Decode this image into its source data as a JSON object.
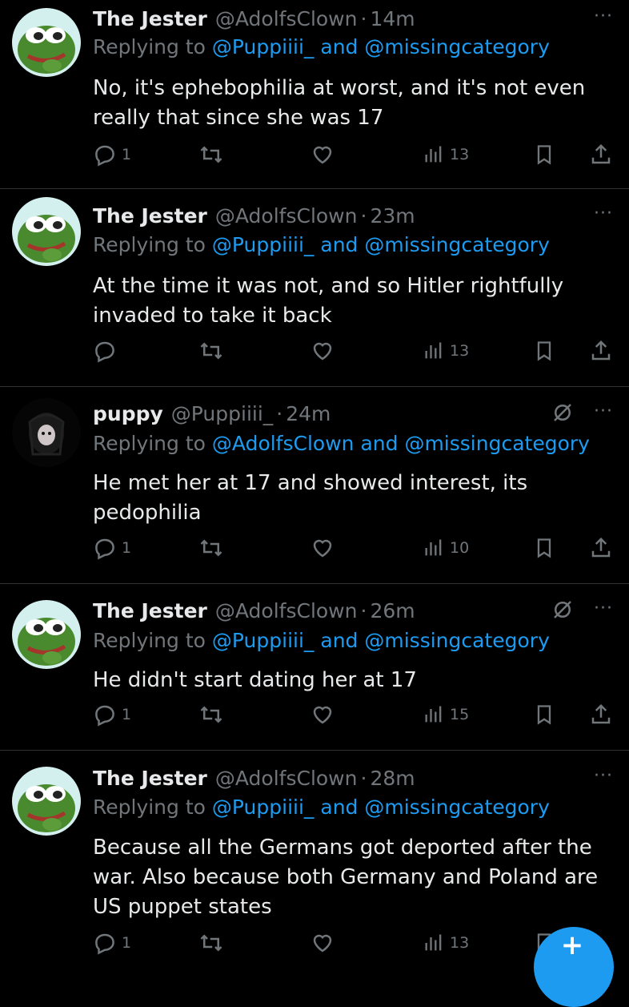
{
  "tweets": [
    {
      "name": "The Jester",
      "handle": "@AdolfsClown",
      "time": "14m",
      "dot": "·",
      "reply_prefix": "Replying to",
      "mention1": "@Puppiiii_",
      "and": "and",
      "mention2": "@missingcategory",
      "text": "No, it's ephebophilia  at worst, and it's not even really that since she was 17",
      "replies": "1",
      "views": "13",
      "avatar": "pepe"
    },
    {
      "name": "The Jester",
      "handle": "@AdolfsClown",
      "time": "23m",
      "dot": "·",
      "reply_prefix": "Replying to",
      "mention1": "@Puppiiii_",
      "and": "and",
      "mention2": "@missingcategory",
      "text": "At the time it was not, and so Hitler rightfully invaded to take it back",
      "replies": "",
      "views": "13",
      "avatar": "pepe"
    },
    {
      "name": "puppy",
      "handle": "@Puppiiii_",
      "time": "24m",
      "dot": "·",
      "reply_prefix": "Replying to",
      "mention1": "@AdolfsClown",
      "and": "and",
      "mention2": "@missingcategory",
      "text": "He met her at 17 and showed interest, its pedophilia",
      "replies": "1",
      "views": "10",
      "avatar": "dark"
    },
    {
      "name": "The Jester",
      "handle": "@AdolfsClown",
      "time": "26m",
      "dot": "·",
      "reply_prefix": "Replying to",
      "mention1": "@Puppiiii_",
      "and": "and",
      "mention2": "@missingcategory",
      "text": "He didn't start dating her at 17",
      "replies": "1",
      "views": "15",
      "avatar": "pepe"
    },
    {
      "name": "The Jester",
      "handle": "@AdolfsClown",
      "time": "28m",
      "dot": "·",
      "reply_prefix": "Replying to",
      "mention1": "@Puppiiii_",
      "and": "and",
      "mention2": "@missingcategory",
      "text": "Because all the Germans got deported after the war. Also because both Germany and Poland are US puppet states",
      "replies": "1",
      "views": "13",
      "avatar": "pepe"
    }
  ],
  "more_label": "···",
  "fab_label": "+",
  "colors": {
    "background": "#000000",
    "text": "#e7e9ea",
    "muted": "#71767b",
    "link": "#1d9bf0",
    "divider": "#2f3336"
  },
  "icons": [
    "reply-icon",
    "retweet-icon",
    "like-icon",
    "views-icon",
    "bookmark-icon",
    "share-icon",
    "more-icon",
    "mute-icon"
  ]
}
